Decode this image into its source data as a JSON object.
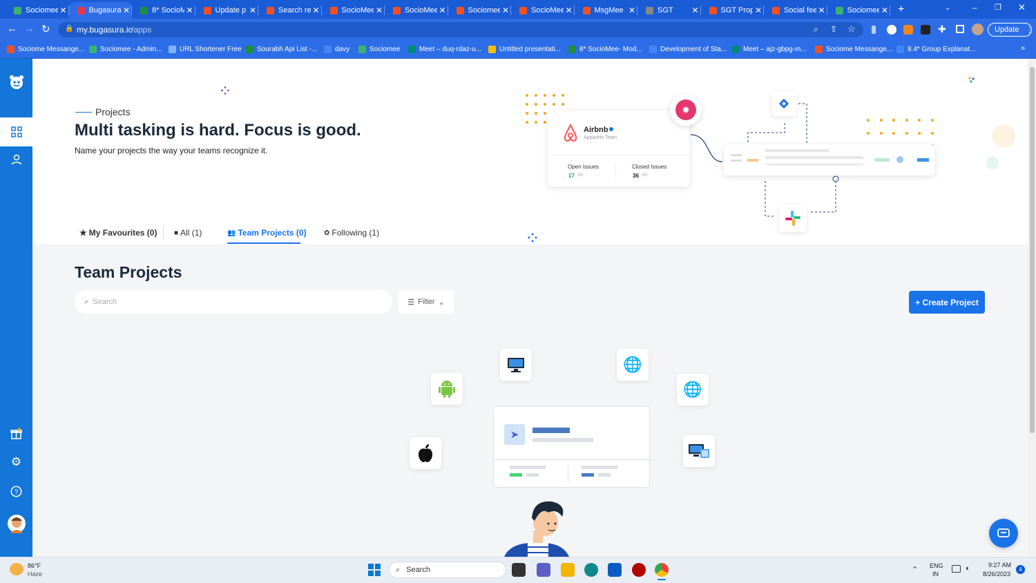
{
  "browser": {
    "tabs": [
      {
        "label": "Sociomee",
        "color": "#3cb371"
      },
      {
        "label": "Bugasura",
        "color": "#e53950"
      },
      {
        "label": "8* SocioM",
        "color": "#1e8e3e"
      },
      {
        "label": "Update p",
        "color": "#f25022"
      },
      {
        "label": "Search re",
        "color": "#f25022"
      },
      {
        "label": "SocioMee",
        "color": "#f25022"
      },
      {
        "label": "SocioMee",
        "color": "#f25022"
      },
      {
        "label": "Sociomee",
        "color": "#f25022"
      },
      {
        "label": "SocioMee",
        "color": "#f25022"
      },
      {
        "label": "MsgMee",
        "color": "#f25022"
      },
      {
        "label": "SGT",
        "color": "#888888"
      },
      {
        "label": "SGT Prop",
        "color": "#f25022"
      },
      {
        "label": "Social fee",
        "color": "#f25022"
      },
      {
        "label": "Sociomee",
        "color": "#3cb371"
      }
    ],
    "new_tab": "+",
    "url_host": "my.bugasura.io",
    "url_path": "/apps",
    "update_label": "Update",
    "bookmarks": [
      {
        "label": "Sociome Messange...",
        "color": "#f25022"
      },
      {
        "label": "Sociomee - Admin...",
        "color": "#3cb371"
      },
      {
        "label": "URL Shortener Free",
        "color": "#7fb3ff"
      },
      {
        "label": "Sourabh Api List -...",
        "color": "#1e8e3e"
      },
      {
        "label": "davy",
        "color": "#4285f4"
      },
      {
        "label": "Sociomee",
        "color": "#3cb371"
      },
      {
        "label": "Meet – duq-rdaz-u...",
        "color": "#00897b"
      },
      {
        "label": "Untitled presentati...",
        "color": "#fbbc04"
      },
      {
        "label": "8* SocioMee- Mod...",
        "color": "#1e8e3e"
      },
      {
        "label": "Development of Sta...",
        "color": "#4285f4"
      },
      {
        "label": "Meet – ajz-gbpg-m...",
        "color": "#00897b"
      },
      {
        "label": "Sociome Messange...",
        "color": "#f25022"
      },
      {
        "label": "8.4* Group Explanat...",
        "color": "#4285f4"
      }
    ]
  },
  "hero": {
    "eyebrow": "Projects",
    "title": "Multi tasking is hard. Focus is good.",
    "subtitle": "Name your projects the way your teams recognize it.",
    "card_title": "Airbnb",
    "card_team": "Appachhi Team",
    "open_label": "Open Issues",
    "open_value": "17",
    "open_total": "/65",
    "closed_label": "Closed Issues",
    "closed_value": "36",
    "closed_total": "/65"
  },
  "project_tabs": [
    {
      "label": "My Favourites (0)"
    },
    {
      "label": "All (1)"
    },
    {
      "label": "Team Projects (0)"
    },
    {
      "label": "Following (1)"
    }
  ],
  "section": {
    "title": "Team Projects",
    "search_placeholder": "Search",
    "filter_label": "Filter",
    "create_label": "+ Create Project"
  },
  "taskbar": {
    "weather_temp": "86°F",
    "weather_desc": "Haze",
    "search_label": "Search",
    "lang1": "ENG",
    "lang2": "IN",
    "time": "9:27 AM",
    "date": "8/26/2023",
    "notif_count": "4"
  },
  "colors": {
    "brand": "#1376d8",
    "chrome": "#2d6ee8",
    "accent": "#1a73e8"
  }
}
